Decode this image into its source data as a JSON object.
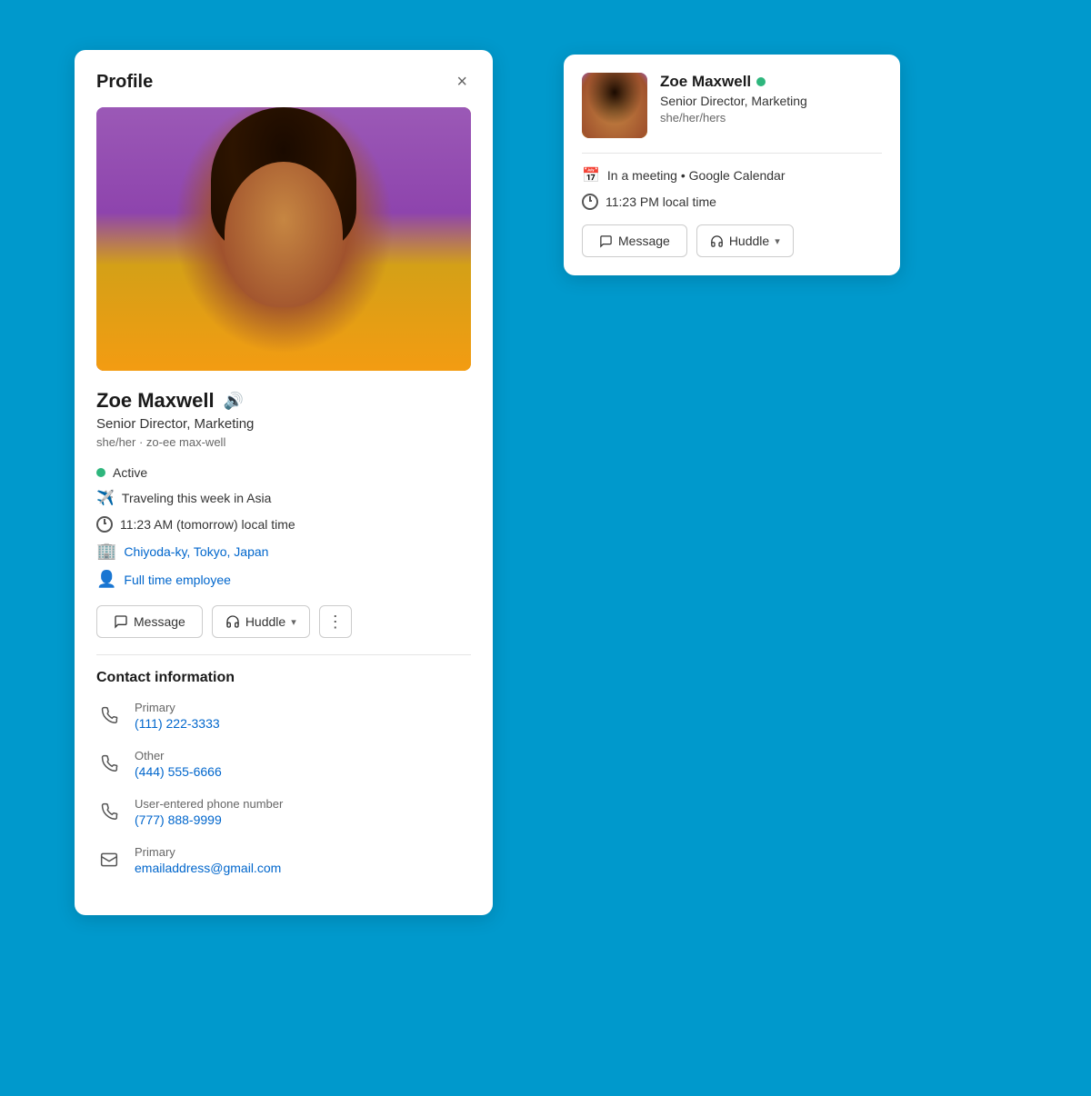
{
  "background_color": "#0099CC",
  "profile_card": {
    "title": "Profile",
    "close_label": "×",
    "user": {
      "name": "Zoe Maxwell",
      "title": "Senior Director, Marketing",
      "pronouns": "she/her · zo-ee max-well",
      "status": "Active",
      "status_color": "#2eb67d",
      "travel_status": "Traveling this week in Asia",
      "local_time": "11:23 AM (tomorrow) local time",
      "location": "Chiyoda-ky, Tokyo, Japan",
      "employment": "Full time employee"
    },
    "actions": {
      "message_label": "Message",
      "huddle_label": "Huddle",
      "more_label": "⋮"
    },
    "contact_section": {
      "title": "Contact information",
      "items": [
        {
          "type": "phone",
          "label": "Primary",
          "value": "(111) 222-3333"
        },
        {
          "type": "phone",
          "label": "Other",
          "value": "(444) 555-6666"
        },
        {
          "type": "phone",
          "label": "User-entered phone number",
          "value": "(777) 888-9999"
        },
        {
          "type": "email",
          "label": "Primary",
          "value": "emailaddress@gmail.com"
        }
      ]
    }
  },
  "popup_card": {
    "user": {
      "name": "Zoe Maxwell",
      "status_color": "#2eb67d",
      "title": "Senior Director, Marketing",
      "pronouns": "she/her/hers"
    },
    "meeting_status": "In a meeting • Google Calendar",
    "local_time": "11:23 PM local time",
    "actions": {
      "message_label": "Message",
      "huddle_label": "Huddle"
    }
  }
}
